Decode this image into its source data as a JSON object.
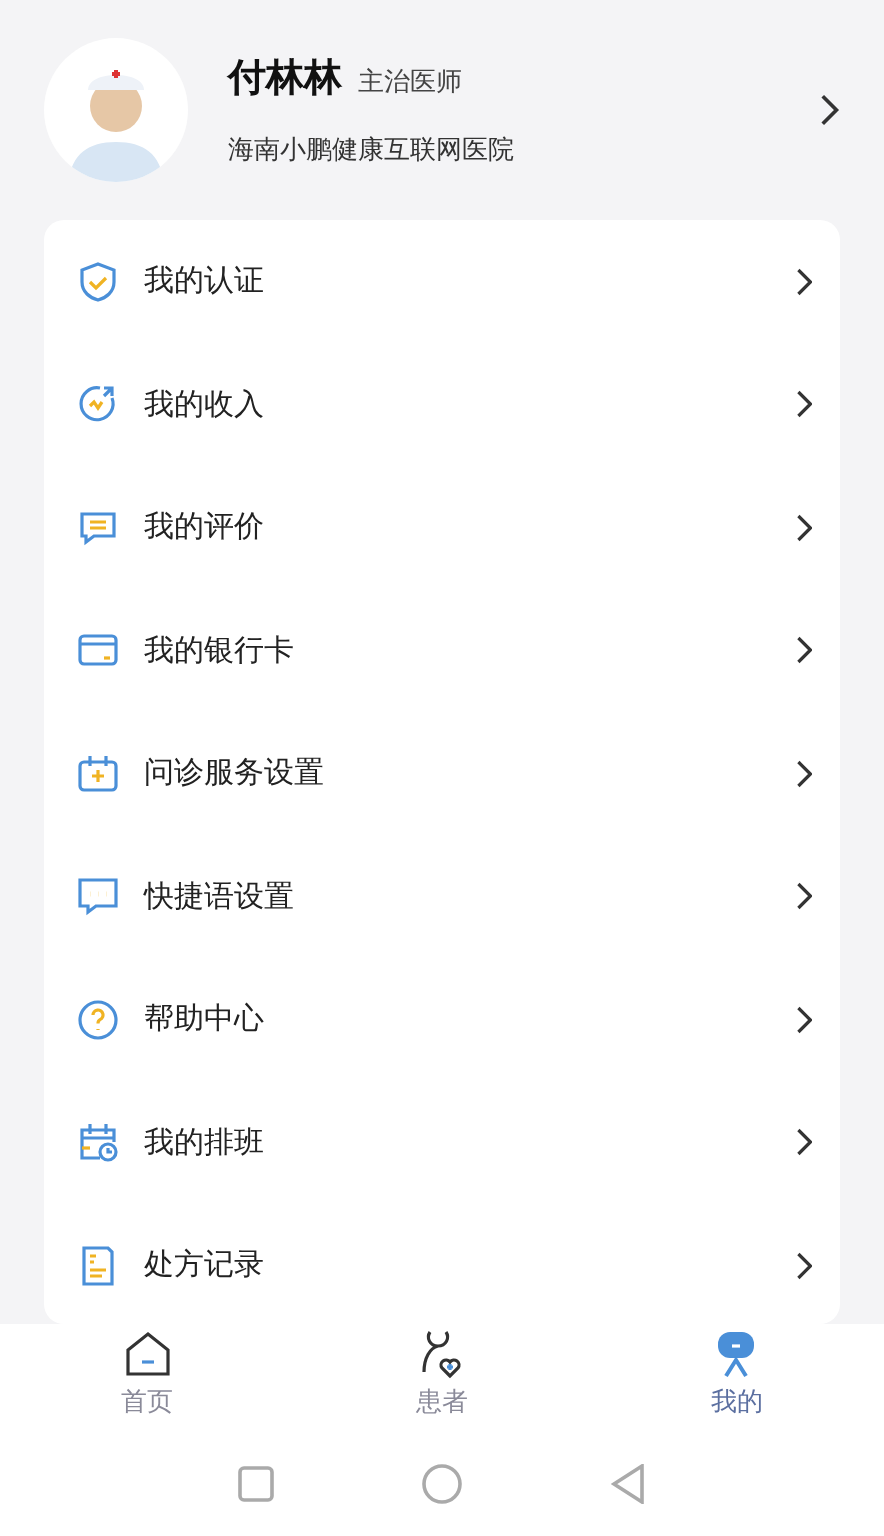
{
  "profile": {
    "name": "付林林",
    "title": "主治医师",
    "hospital": "海南小鹏健康互联网医院"
  },
  "menu": [
    {
      "kind": "shield",
      "label": "我的认证"
    },
    {
      "kind": "income",
      "label": "我的收入"
    },
    {
      "kind": "comment",
      "label": "我的评价"
    },
    {
      "kind": "card",
      "label": "我的银行卡"
    },
    {
      "kind": "calendar-plus",
      "label": "问诊服务设置"
    },
    {
      "kind": "chat",
      "label": "快捷语设置"
    },
    {
      "kind": "help",
      "label": "帮助中心"
    },
    {
      "kind": "schedule",
      "label": "我的排班"
    },
    {
      "kind": "rx",
      "label": "处方记录"
    }
  ],
  "tabs": [
    {
      "kind": "home",
      "label": "首页",
      "selected": false
    },
    {
      "kind": "patients",
      "label": "患者",
      "selected": false
    },
    {
      "kind": "me",
      "label": "我的",
      "selected": true
    }
  ]
}
